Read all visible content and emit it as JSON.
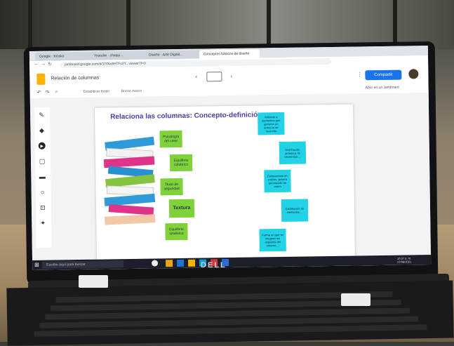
{
  "browser": {
    "tabs": [
      "Google · Kiosko",
      "Youtube · chaqui...",
      "Diseño · Arte Digital...",
      "Conceptos básicos de diseño"
    ],
    "url": "jamboard.google.com/d/1f7Xw9eTFv2Y...viewer?f=0"
  },
  "app": {
    "doc_title": "Relación de columnas",
    "share_label": "Compartir",
    "jamboard_link": "Abrir en un Jamboard",
    "toolbar_items": [
      "Establecer fondo",
      "Borrar marco"
    ]
  },
  "slide": {
    "title": "Relaciona las columnas: Concepto-definición",
    "green_notes": [
      "Psicología del color",
      "Equilibrio simétrico",
      "Texto de seguridad",
      "Textura",
      "Equilibrio simétrico"
    ],
    "blue_notes": [
      "Atrévete a elementos que generen un armonía de recorrido",
      "Distribución armónica de elementos ...",
      "Composición en rostros, genera percepción de orden",
      "Distribución de elementos ...",
      "Forma en que se integran los aspectos del entorno ..."
    ]
  },
  "taskbar": {
    "search_placeholder": "Escribe aquí para buscar",
    "clock": "10:37 a. m.",
    "date": "27/06/2021"
  },
  "device": {
    "brand": "DELL"
  }
}
